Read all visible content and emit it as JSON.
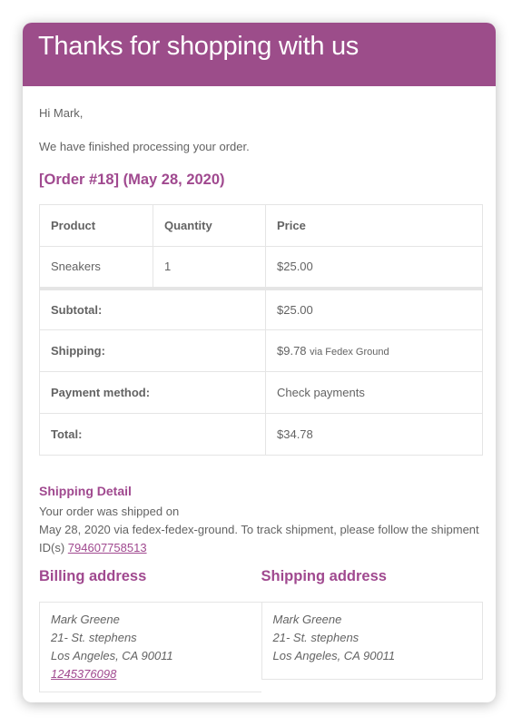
{
  "header": {
    "title": "Thanks for shopping with us"
  },
  "greeting": "Hi Mark,",
  "intro": "We have finished processing your order.",
  "order_title": "[Order #18] (May 28, 2020)",
  "table": {
    "headers": [
      "Product",
      "Quantity",
      "Price"
    ],
    "rows": [
      {
        "product": "Sneakers",
        "quantity": "1",
        "price": "$25.00"
      }
    ],
    "totals": [
      {
        "label": "Subtotal:",
        "value": "$25.00",
        "note": ""
      },
      {
        "label": "Shipping:",
        "value": "$9.78",
        "note": "via Fedex Ground"
      },
      {
        "label": "Payment method:",
        "value": "Check payments",
        "note": ""
      },
      {
        "label": "Total:",
        "value": "$34.78",
        "note": ""
      }
    ]
  },
  "shipping_detail": {
    "heading": "Shipping Detail",
    "line1": "Your order was shipped on",
    "line2": "May 28, 2020 via fedex-fedex-ground. To track shipment, please follow the shipment ID(s)",
    "tracking_id": "794607758513"
  },
  "billing": {
    "heading": "Billing address",
    "name": "Mark Greene",
    "street": "21- St. stephens",
    "city": "Los Angeles, CA 90011",
    "phone": "1245376098"
  },
  "shipping": {
    "heading": "Shipping address",
    "name": "Mark Greene",
    "street": "21- St. stephens",
    "city": "Los Angeles, CA 90011"
  },
  "colors": {
    "brand": "#9c4d8a",
    "accent_text": "#a0498f",
    "body_text": "#636363",
    "border": "#e5e5e5"
  }
}
